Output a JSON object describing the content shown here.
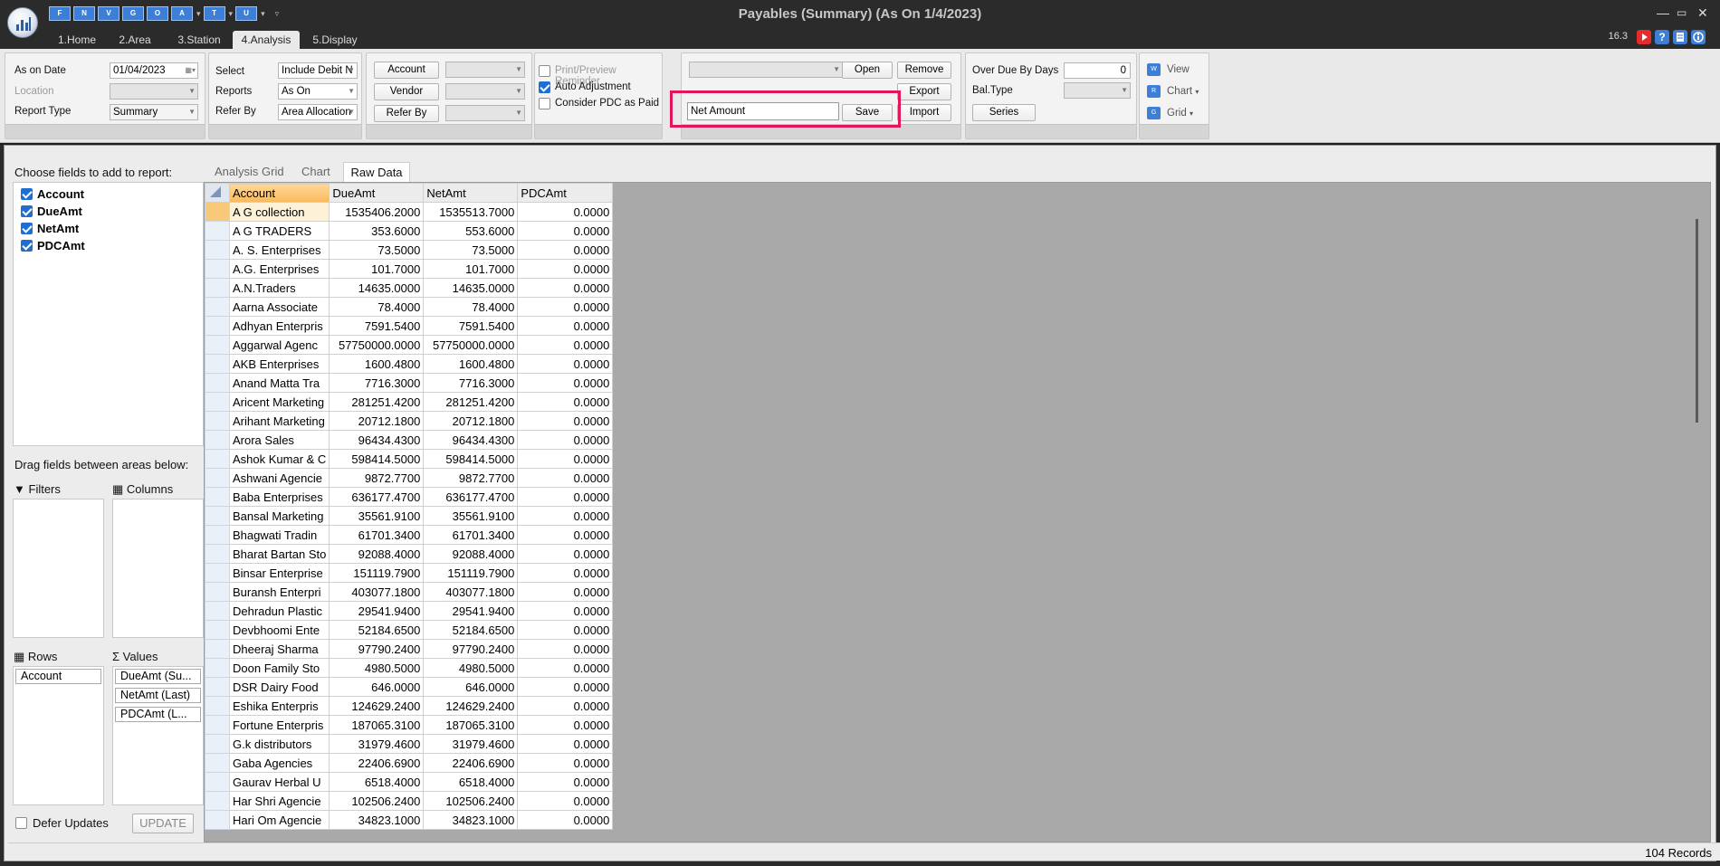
{
  "window": {
    "title": "Payables (Summary) (As On 1/4/2023)",
    "version": "16.3"
  },
  "qat": {
    "buttons": [
      "F",
      "N",
      "V",
      "G",
      "O",
      "A",
      "T",
      "U"
    ]
  },
  "tabs": [
    "1.Home",
    "2.Area",
    "3.Station",
    "4.Analysis",
    "5.Display"
  ],
  "ribbon": {
    "as_on_date_label": "As on Date",
    "as_on_date_value": "01/04/2023",
    "location_label": "Location",
    "location_value": "",
    "report_type_label": "Report Type",
    "report_type_value": "Summary",
    "select_label": "Select",
    "select_value": "Include Debit N",
    "reports_label": "Reports",
    "reports_value": "As On",
    "refer_by_label": "Refer By",
    "refer_by_value": "Area Allocation",
    "account_btn": "Account",
    "vendor_btn": "Vendor",
    "refer_by_btn": "Refer By",
    "print_reminder": "Print/Preview Reminder",
    "auto_adjustment": "Auto Adjustment",
    "consider_pdc": "Consider PDC as Paid",
    "layout_select_value": "",
    "open_btn": "Open",
    "remove_btn": "Remove",
    "export_btn": "Export",
    "import_btn": "Import",
    "layout_name_value": "Net Amount",
    "save_btn": "Save",
    "overdue_label": "Over Due By Days",
    "overdue_value": "0",
    "bal_type_label": "Bal.Type",
    "bal_type_value": "",
    "series_btn": "Series",
    "view_btn": "View",
    "chart_btn": "Chart",
    "grid_btn": "Grid"
  },
  "field_list": {
    "title": "Choose fields to add to report:",
    "fields": [
      "Account",
      "DueAmt",
      "NetAmt",
      "PDCAmt"
    ],
    "drag_text": "Drag fields between areas below:",
    "filters": "Filters",
    "columns": "Columns",
    "rows": "Rows",
    "values": "Values",
    "rows_items": [
      "Account"
    ],
    "values_items": [
      "DueAmt (Su...",
      "NetAmt (Last)",
      "PDCAmt (L..."
    ],
    "defer_updates": "Defer Updates",
    "update_btn": "UPDATE"
  },
  "grid": {
    "tabs": [
      "Analysis Grid",
      "Chart",
      "Raw Data"
    ],
    "columns": [
      "Account",
      "DueAmt",
      "NetAmt",
      "PDCAmt"
    ],
    "rows": [
      [
        "A G collection",
        "1535406.2000",
        "1535513.7000",
        "0.0000"
      ],
      [
        "A G TRADERS",
        "353.6000",
        "553.6000",
        "0.0000"
      ],
      [
        "A. S. Enterprises",
        "73.5000",
        "73.5000",
        "0.0000"
      ],
      [
        "A.G. Enterprises",
        "101.7000",
        "101.7000",
        "0.0000"
      ],
      [
        "A.N.Traders",
        "14635.0000",
        "14635.0000",
        "0.0000"
      ],
      [
        "Aarna Associate",
        "78.4000",
        "78.4000",
        "0.0000"
      ],
      [
        "Adhyan Enterpris",
        "7591.5400",
        "7591.5400",
        "0.0000"
      ],
      [
        "Aggarwal Agenc",
        "57750000.0000",
        "57750000.0000",
        "0.0000"
      ],
      [
        "AKB Enterprises",
        "1600.4800",
        "1600.4800",
        "0.0000"
      ],
      [
        "Anand Matta Tra",
        "7716.3000",
        "7716.3000",
        "0.0000"
      ],
      [
        "Aricent Marketing",
        "281251.4200",
        "281251.4200",
        "0.0000"
      ],
      [
        "Arihant Marketing",
        "20712.1800",
        "20712.1800",
        "0.0000"
      ],
      [
        "Arora Sales",
        "96434.4300",
        "96434.4300",
        "0.0000"
      ],
      [
        "Ashok Kumar & C",
        "598414.5000",
        "598414.5000",
        "0.0000"
      ],
      [
        "Ashwani Agencie",
        "9872.7700",
        "9872.7700",
        "0.0000"
      ],
      [
        "Baba Enterprises",
        "636177.4700",
        "636177.4700",
        "0.0000"
      ],
      [
        "Bansal Marketing",
        "35561.9100",
        "35561.9100",
        "0.0000"
      ],
      [
        "Bhagwati Tradin",
        "61701.3400",
        "61701.3400",
        "0.0000"
      ],
      [
        "Bharat Bartan Sto",
        "92088.4000",
        "92088.4000",
        "0.0000"
      ],
      [
        "Binsar Enterprise",
        "151119.7900",
        "151119.7900",
        "0.0000"
      ],
      [
        "Buransh Enterpri",
        "403077.1800",
        "403077.1800",
        "0.0000"
      ],
      [
        "Dehradun Plastic",
        "29541.9400",
        "29541.9400",
        "0.0000"
      ],
      [
        "Devbhoomi Ente",
        "52184.6500",
        "52184.6500",
        "0.0000"
      ],
      [
        "Dheeraj Sharma",
        "97790.2400",
        "97790.2400",
        "0.0000"
      ],
      [
        "Doon Family Sto",
        "4980.5000",
        "4980.5000",
        "0.0000"
      ],
      [
        "DSR Dairy Food",
        "646.0000",
        "646.0000",
        "0.0000"
      ],
      [
        "Eshika Enterpris",
        "124629.2400",
        "124629.2400",
        "0.0000"
      ],
      [
        "Fortune Enterpris",
        "187065.3100",
        "187065.3100",
        "0.0000"
      ],
      [
        "G.k distributors",
        "31979.4600",
        "31979.4600",
        "0.0000"
      ],
      [
        "Gaba Agencies",
        "22406.6900",
        "22406.6900",
        "0.0000"
      ],
      [
        "Gaurav Herbal U",
        "6518.4000",
        "6518.4000",
        "0.0000"
      ],
      [
        "Har Shri Agencie",
        "102506.2400",
        "102506.2400",
        "0.0000"
      ],
      [
        "Hari Om Agencie",
        "34823.1000",
        "34823.1000",
        "0.0000"
      ]
    ]
  },
  "status": {
    "records": "104 Records"
  }
}
